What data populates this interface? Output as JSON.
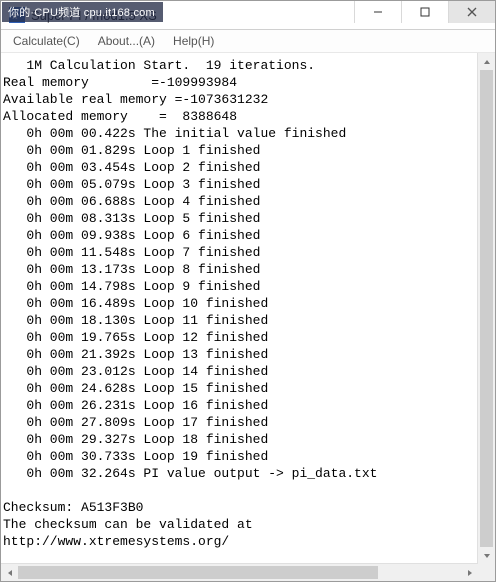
{
  "watermark": "你的·CPU频道 cpu.it168.com",
  "titlebar": {
    "title": "Super PI / mod1.5 XS"
  },
  "menu": {
    "calculate": "Calculate(C)",
    "about": "About...(A)",
    "help": "Help(H)"
  },
  "output": {
    "header": "   1M Calculation Start.  19 iterations.",
    "real_memory": "Real memory        =-109993984",
    "avail_memory": "Available real memory =-1073631232",
    "alloc_memory": "Allocated memory    =  8388648",
    "lines": [
      "   0h 00m 00.422s The initial value finished",
      "   0h 00m 01.829s Loop 1 finished",
      "   0h 00m 03.454s Loop 2 finished",
      "   0h 00m 05.079s Loop 3 finished",
      "   0h 00m 06.688s Loop 4 finished",
      "   0h 00m 08.313s Loop 5 finished",
      "   0h 00m 09.938s Loop 6 finished",
      "   0h 00m 11.548s Loop 7 finished",
      "   0h 00m 13.173s Loop 8 finished",
      "   0h 00m 14.798s Loop 9 finished",
      "   0h 00m 16.489s Loop 10 finished",
      "   0h 00m 18.130s Loop 11 finished",
      "   0h 00m 19.765s Loop 12 finished",
      "   0h 00m 21.392s Loop 13 finished",
      "   0h 00m 23.012s Loop 14 finished",
      "   0h 00m 24.628s Loop 15 finished",
      "   0h 00m 26.231s Loop 16 finished",
      "   0h 00m 27.809s Loop 17 finished",
      "   0h 00m 29.327s Loop 18 finished",
      "   0h 00m 30.733s Loop 19 finished",
      "   0h 00m 32.264s PI value output -> pi_data.txt"
    ],
    "blank": "",
    "checksum": "Checksum: A513F3B0",
    "validate1": "The checksum can be validated at",
    "validate2": "http://www.xtremesystems.org/"
  }
}
